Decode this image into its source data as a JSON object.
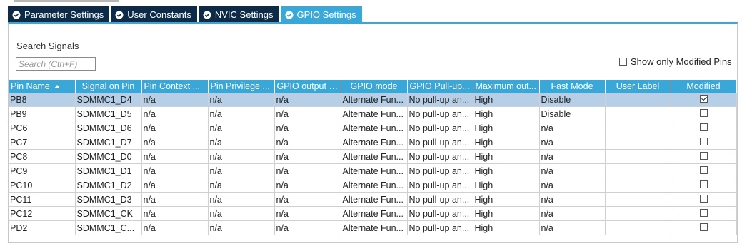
{
  "tabs": [
    {
      "label": "Parameter Settings",
      "icon": "check-circle-icon",
      "active": false
    },
    {
      "label": "User Constants",
      "icon": "check-circle-icon",
      "active": false
    },
    {
      "label": "NVIC Settings",
      "icon": "check-circle-icon",
      "active": false
    },
    {
      "label": "GPIO Settings",
      "icon": "check-circle-icon",
      "active": true
    }
  ],
  "search": {
    "label": "Search Signals",
    "placeholder": "Search (Ctrl+F)",
    "value": ""
  },
  "filter": {
    "show_only_modified_label": "Show only Modified Pins",
    "checked": false
  },
  "table": {
    "columns": [
      "Pin Name",
      "Signal on Pin",
      "Pin Context ...",
      "Pin Privilege ...",
      "GPIO output l...",
      "GPIO mode",
      "GPIO Pull-up...",
      "Maximum out...",
      "Fast Mode",
      "User Label",
      "Modified"
    ],
    "sorted_column": "Pin Name",
    "rows": [
      {
        "pin": "PB8",
        "signal": "SDMMC1_D4",
        "context": "n/a",
        "privilege": "n/a",
        "output_level": "n/a",
        "mode": "Alternate Fun...",
        "pull": "No pull-up an...",
        "max_speed": "High",
        "fast_mode": "Disable",
        "user_label": "",
        "modified": true,
        "selected": true
      },
      {
        "pin": "PB9",
        "signal": "SDMMC1_D5",
        "context": "n/a",
        "privilege": "n/a",
        "output_level": "n/a",
        "mode": "Alternate Fun...",
        "pull": "No pull-up an...",
        "max_speed": "High",
        "fast_mode": "Disable",
        "user_label": "",
        "modified": false,
        "selected": false
      },
      {
        "pin": "PC6",
        "signal": "SDMMC1_D6",
        "context": "n/a",
        "privilege": "n/a",
        "output_level": "n/a",
        "mode": "Alternate Fun...",
        "pull": "No pull-up an...",
        "max_speed": "High",
        "fast_mode": "n/a",
        "user_label": "",
        "modified": false,
        "selected": false
      },
      {
        "pin": "PC7",
        "signal": "SDMMC1_D7",
        "context": "n/a",
        "privilege": "n/a",
        "output_level": "n/a",
        "mode": "Alternate Fun...",
        "pull": "No pull-up an...",
        "max_speed": "High",
        "fast_mode": "n/a",
        "user_label": "",
        "modified": false,
        "selected": false
      },
      {
        "pin": "PC8",
        "signal": "SDMMC1_D0",
        "context": "n/a",
        "privilege": "n/a",
        "output_level": "n/a",
        "mode": "Alternate Fun...",
        "pull": "No pull-up an...",
        "max_speed": "High",
        "fast_mode": "n/a",
        "user_label": "",
        "modified": false,
        "selected": false
      },
      {
        "pin": "PC9",
        "signal": "SDMMC1_D1",
        "context": "n/a",
        "privilege": "n/a",
        "output_level": "n/a",
        "mode": "Alternate Fun...",
        "pull": "No pull-up an...",
        "max_speed": "High",
        "fast_mode": "n/a",
        "user_label": "",
        "modified": false,
        "selected": false
      },
      {
        "pin": "PC10",
        "signal": "SDMMC1_D2",
        "context": "n/a",
        "privilege": "n/a",
        "output_level": "n/a",
        "mode": "Alternate Fun...",
        "pull": "No pull-up an...",
        "max_speed": "High",
        "fast_mode": "n/a",
        "user_label": "",
        "modified": false,
        "selected": false
      },
      {
        "pin": "PC11",
        "signal": "SDMMC1_D3",
        "context": "n/a",
        "privilege": "n/a",
        "output_level": "n/a",
        "mode": "Alternate Fun...",
        "pull": "No pull-up an...",
        "max_speed": "High",
        "fast_mode": "n/a",
        "user_label": "",
        "modified": false,
        "selected": false
      },
      {
        "pin": "PC12",
        "signal": "SDMMC1_CK",
        "context": "n/a",
        "privilege": "n/a",
        "output_level": "n/a",
        "mode": "Alternate Fun...",
        "pull": "No pull-up an...",
        "max_speed": "High",
        "fast_mode": "n/a",
        "user_label": "",
        "modified": false,
        "selected": false
      },
      {
        "pin": "PD2",
        "signal": "SDMMC1_C...",
        "context": "n/a",
        "privilege": "n/a",
        "output_level": "n/a",
        "mode": "Alternate Fun...",
        "pull": "No pull-up an...",
        "max_speed": "High",
        "fast_mode": "n/a",
        "user_label": "",
        "modified": false,
        "selected": false
      }
    ]
  },
  "colors": {
    "tab_bg": "#0d2a47",
    "accent": "#39a8d8",
    "selected_row": "#b7cfe6"
  }
}
